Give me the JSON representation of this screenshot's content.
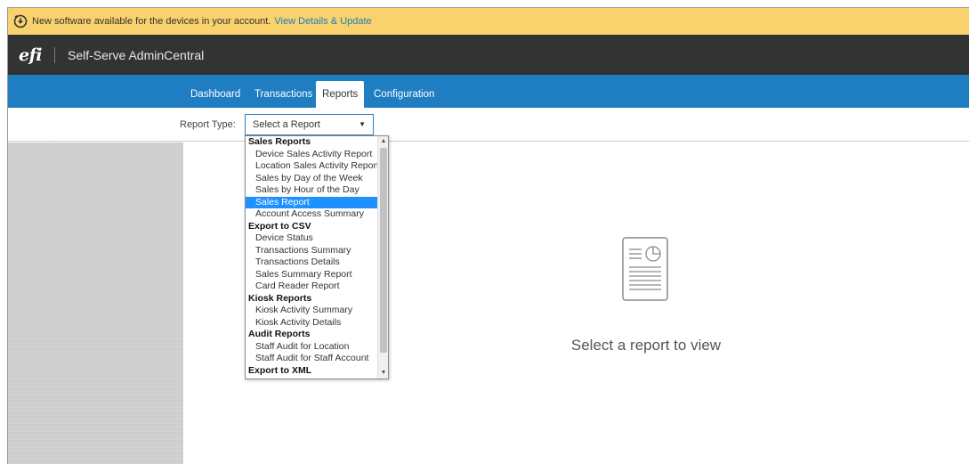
{
  "banner": {
    "message": "New software available for the devices in your account.",
    "link": "View Details & Update",
    "background": "#f9d16d",
    "icon": "update-icon"
  },
  "brand": {
    "logo": "efi",
    "app_title": "Self-Serve AdminCentral"
  },
  "nav": {
    "accent": "#1f7dc1",
    "tabs": [
      {
        "label": "Dashboard",
        "active": false
      },
      {
        "label": "Transactions",
        "active": false
      },
      {
        "label": "Reports",
        "active": true
      },
      {
        "label": "Configuration",
        "active": false
      }
    ]
  },
  "filter": {
    "report_type_label": "Report Type:",
    "selected_value": "Select a Report"
  },
  "dropdown": {
    "highlighted": "Sales Report",
    "groups": [
      {
        "label": "Sales Reports",
        "options": [
          "Device Sales Activity Report",
          "Location Sales Activity Report",
          "Sales by Day of the Week",
          "Sales by Hour of the Day",
          "Sales Report",
          "Account Access Summary"
        ]
      },
      {
        "label": "Export to CSV",
        "options": [
          "Device Status",
          "Transactions Summary",
          "Transactions Details",
          "Sales Summary Report",
          "Card Reader Report"
        ]
      },
      {
        "label": "Kiosk Reports",
        "options": [
          "Kiosk Activity Summary",
          "Kiosk Activity Details"
        ]
      },
      {
        "label": "Audit Reports",
        "options": [
          "Staff Audit for Location",
          "Staff Audit for Staff Account"
        ]
      },
      {
        "label": "Export to XML",
        "options": []
      }
    ]
  },
  "content": {
    "empty_message": "Select a report to view",
    "icon": "report-document-icon"
  }
}
